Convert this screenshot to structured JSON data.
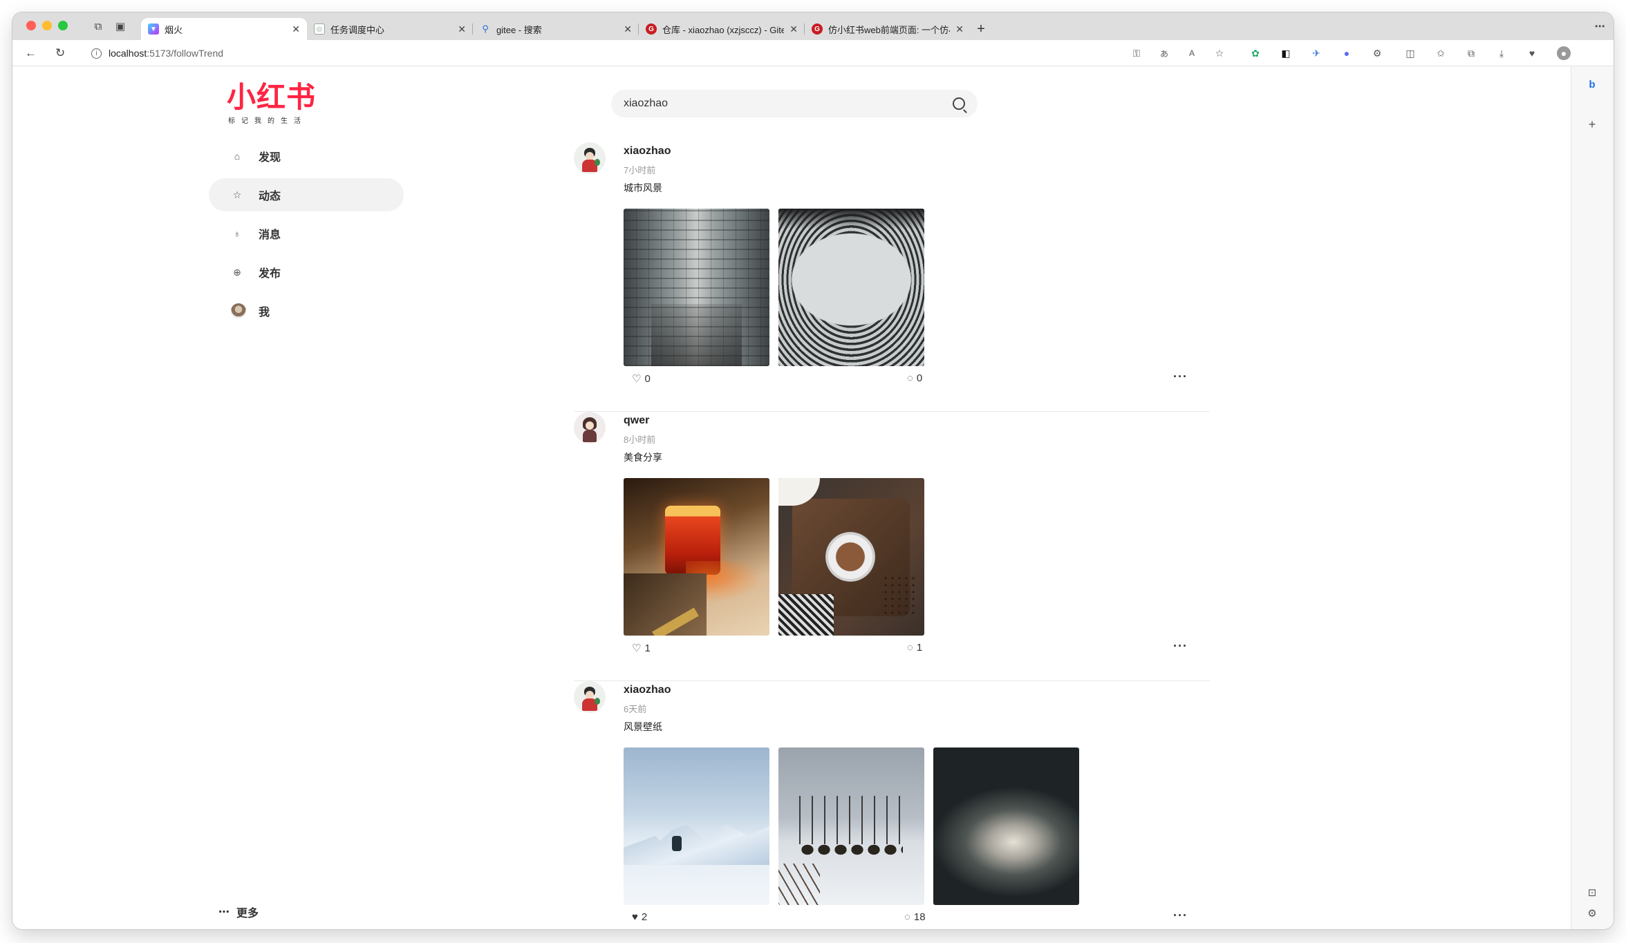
{
  "browser": {
    "tabs": [
      {
        "title": "烟火",
        "favicon": "vite-icon",
        "active": true
      },
      {
        "title": "任务调度中心",
        "favicon": "globe-icon",
        "active": false
      },
      {
        "title": "gitee - 搜索",
        "favicon": "search-icon",
        "active": false
      },
      {
        "title": "仓库 - xiaozhao (xzjsccz) - Gitee",
        "favicon": "gitee-icon",
        "active": false
      },
      {
        "title": "仿小红书web前端页面: 一个仿小红书",
        "favicon": "gitee-icon",
        "active": false
      }
    ],
    "url_host": "localhost",
    "url_path": ":5173/followTrend"
  },
  "app": {
    "logo_text": "小红书",
    "logo_tagline": "标记我的生活",
    "brand_color": "#ff2442",
    "search_value": "xiaozhao",
    "nav": [
      {
        "label": "发现",
        "icon": "home-icon",
        "active": false
      },
      {
        "label": "动态",
        "icon": "star-icon",
        "active": true
      },
      {
        "label": "消息",
        "icon": "bell-icon",
        "active": false
      },
      {
        "label": "发布",
        "icon": "plus-circle-icon",
        "active": false
      },
      {
        "label": "我",
        "icon": "avatar-icon",
        "active": false
      }
    ],
    "more_label": "更多",
    "posts": [
      {
        "username": "xiaozhao",
        "time": "7小时前",
        "desc": "城市风景",
        "likes": "0",
        "comments": "0",
        "liked": false,
        "images": [
          "atrium-architecture",
          "curved-facade-architecture"
        ]
      },
      {
        "username": "qwer",
        "time": "8小时前",
        "desc": "美食分享",
        "likes": "1",
        "comments": "1",
        "liked": false,
        "images": [
          "red-drink-glass",
          "coffee-on-wooden-board"
        ]
      },
      {
        "username": "xiaozhao",
        "time": "6天前",
        "desc": "风景壁纸",
        "likes": "2",
        "comments": "18",
        "liked": true,
        "images": [
          "glacier-snow",
          "bison-in-snowfield",
          "dark-cloud-sky"
        ]
      }
    ]
  }
}
